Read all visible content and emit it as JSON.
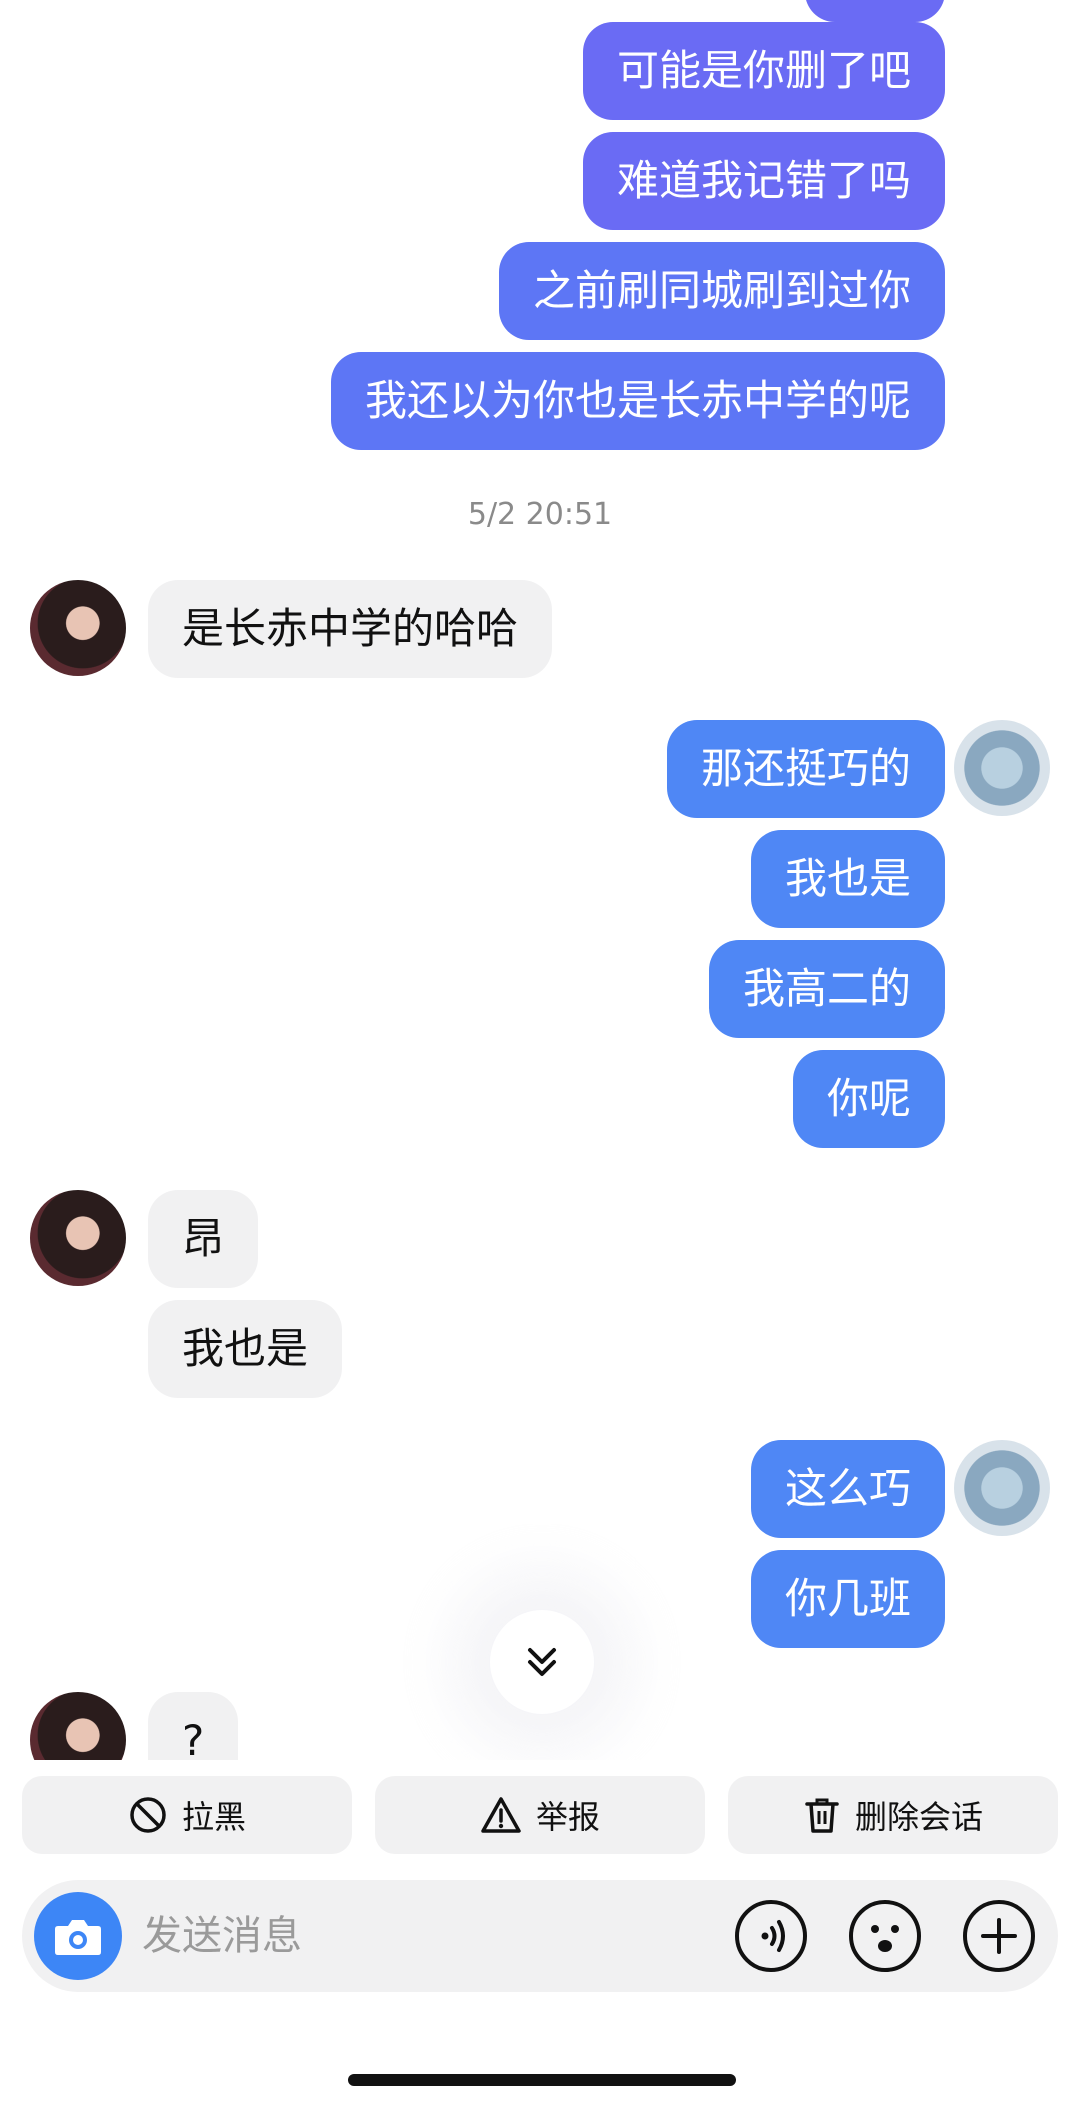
{
  "messages": {
    "top1": "可能是你删了吧",
    "top2": "难道我记错了吗",
    "top3": "之前刷同城刷到过你",
    "top4": "我还以为你也是长赤中学的呢",
    "timestamp": "5/2 20:51",
    "in1": "是长赤中学的哈哈",
    "out1": "那还挺巧的",
    "out2": "我也是",
    "out3": "我高二的",
    "out4": "你呢",
    "in2": "昂",
    "in3": "我也是",
    "out5": "这么巧",
    "out6": "你几班",
    "in4": "?"
  },
  "actions": {
    "block": "拉黑",
    "report": "举报",
    "delete": "删除会话"
  },
  "input": {
    "placeholder": "发送消息"
  },
  "icons": {
    "block": "block-icon",
    "report": "warning-icon",
    "delete": "trash-icon",
    "camera": "camera-icon",
    "voice": "voice-icon",
    "emoji": "emoji-icon",
    "plus": "plus-icon",
    "scroll": "double-chevron-down-icon"
  },
  "colors": {
    "outgoing_purple": "#6a6bf4",
    "outgoing_blue": "#4f87f5",
    "incoming": "#f1f1f2",
    "camera": "#3d86f6"
  }
}
